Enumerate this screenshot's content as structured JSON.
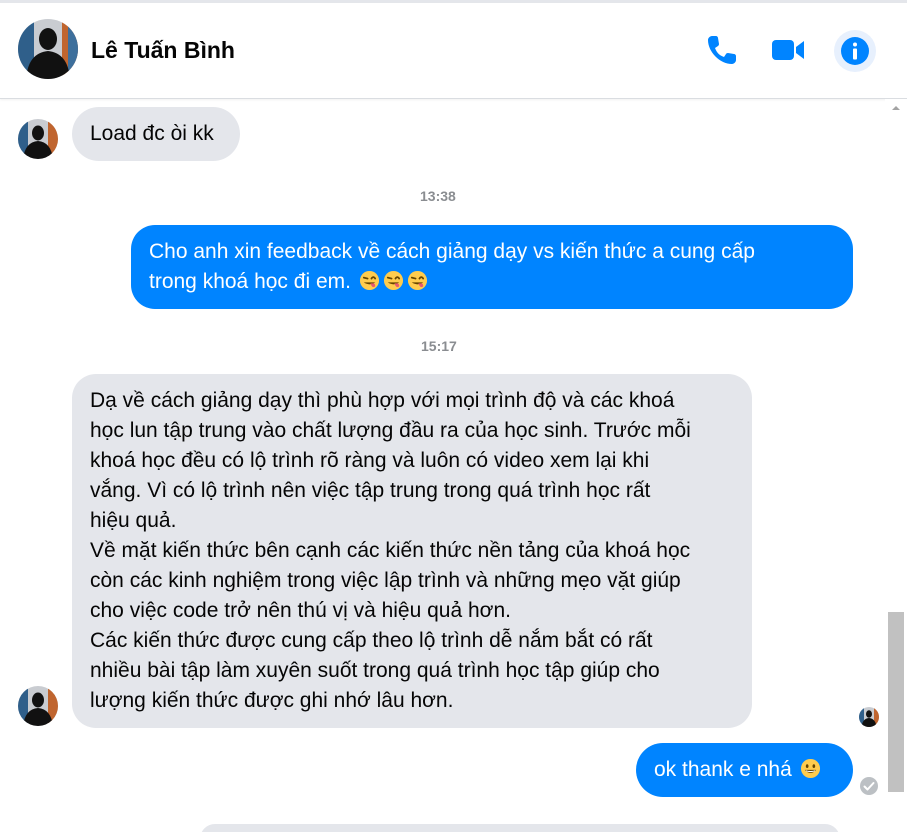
{
  "header": {
    "contact_name": "Lê Tuấn Bình",
    "icons": [
      "phone-icon",
      "video-call-icon",
      "info-icon"
    ]
  },
  "colors": {
    "accent": "#0084ff",
    "incoming_bubble": "#e4e6eb",
    "timestamp": "#8a8d91"
  },
  "messages": [
    {
      "direction": "incoming",
      "lines": [
        "Load đc òi kk"
      ]
    },
    {
      "timestamp": "13:38"
    },
    {
      "direction": "outgoing",
      "lines": [
        "Cho anh xin feedback về cách giảng dạy vs kiến thức a cung cấp",
        "trong khoá học đi em."
      ],
      "emojis": [
        "winking-tongue-emoji",
        "winking-tongue-emoji",
        "winking-tongue-emoji"
      ]
    },
    {
      "timestamp": "15:17"
    },
    {
      "direction": "incoming",
      "lines": [
        "Dạ về cách giảng dạy thì phù hợp với mọi trình độ và các khoá",
        "học lun tập trung vào chất lượng đầu ra của học sinh. Trước mỗi",
        "khoá học đều có lộ trình rõ ràng và luôn có video xem lại khi",
        "vắng. Vì có lộ trình nên việc tập trung trong quá trình học rất",
        "hiệu quả.",
        "Về mặt kiến thức bên cạnh các kiến thức nền tảng của khoá học",
        "còn các kinh nghiệm trong việc lập trình và những mẹo vặt giúp",
        "cho việc code trở nên thú vị và hiệu quả hơn.",
        "Các kiến thức được cung cấp theo lộ trình dễ nắm bắt có rất",
        "nhiều bài tập làm xuyên suốt trong quá trình học tập giúp cho",
        "lượng kiến thức được ghi nhớ lâu hơn."
      ]
    },
    {
      "direction": "outgoing",
      "lines": [
        "ok thank e nhá"
      ],
      "emojis": [
        "grinning-emoji"
      ]
    }
  ]
}
